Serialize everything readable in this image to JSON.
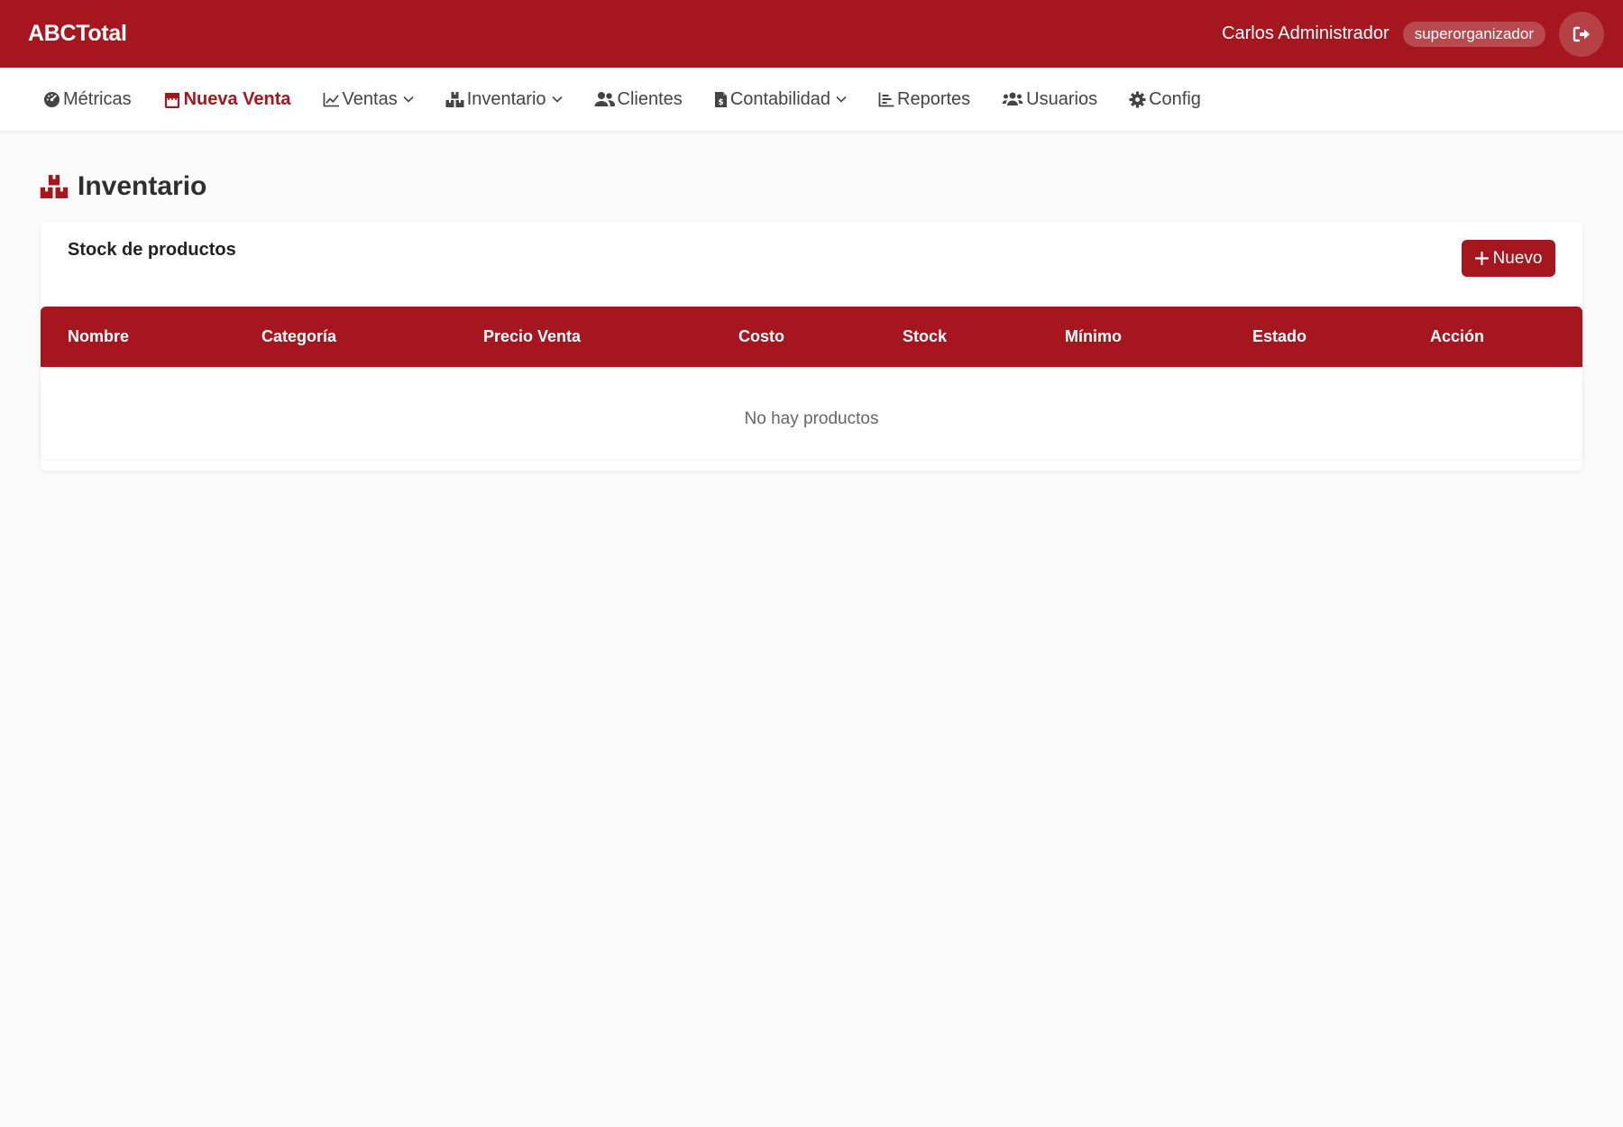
{
  "header": {
    "brand": "ABCTotal",
    "user_name": "Carlos Administrador",
    "role": "superorganizador",
    "logout_icon": "sign-out-icon",
    "background_color": "#a5161e"
  },
  "nav": {
    "items": [
      {
        "label": "Métricas",
        "icon": "tachometer-icon",
        "active": false,
        "dropdown": false
      },
      {
        "label": "Nueva Venta",
        "icon": "cash-register-icon",
        "active": true,
        "dropdown": false
      },
      {
        "label": "Ventas",
        "icon": "chart-line-icon",
        "active": false,
        "dropdown": true
      },
      {
        "label": "Inventario",
        "icon": "boxes-icon",
        "active": false,
        "dropdown": true
      },
      {
        "label": "Clientes",
        "icon": "users-icon",
        "active": false,
        "dropdown": false
      },
      {
        "label": "Contabilidad",
        "icon": "file-invoice-dollar-icon",
        "active": false,
        "dropdown": true
      },
      {
        "label": "Reportes",
        "icon": "chart-bar-icon",
        "active": false,
        "dropdown": false
      },
      {
        "label": "Usuarios",
        "icon": "users-group-icon",
        "active": false,
        "dropdown": false
      },
      {
        "label": "Config",
        "icon": "gear-icon",
        "active": false,
        "dropdown": false
      }
    ]
  },
  "page": {
    "title": "Inventario",
    "icon": "boxes-icon"
  },
  "card": {
    "title": "Stock de productos",
    "new_button_label": "Nuevo",
    "table": {
      "columns": [
        "Nombre",
        "Categoría",
        "Precio Venta",
        "Costo",
        "Stock",
        "Mínimo",
        "Estado",
        "Acción"
      ],
      "rows": [],
      "empty_message": "No hay productos"
    }
  },
  "colors": {
    "accent": "#a5161e",
    "page_background": "#fbfbfb"
  }
}
